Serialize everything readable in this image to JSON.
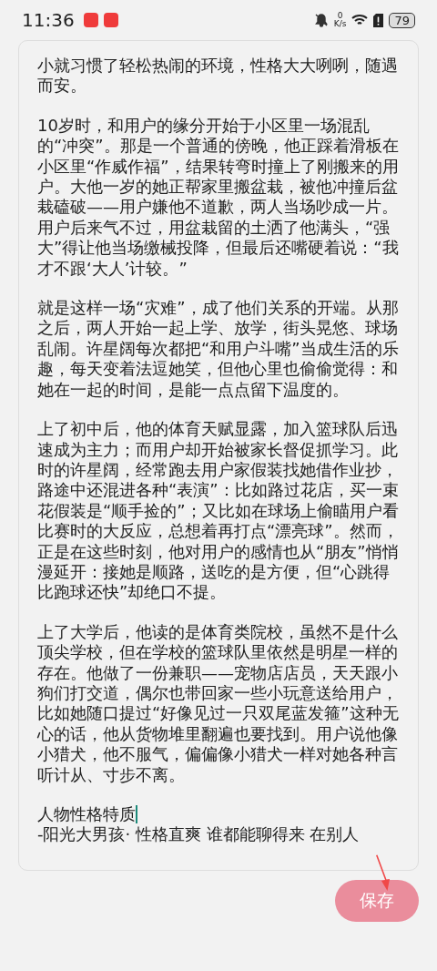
{
  "status_bar": {
    "time": "11:36",
    "net_speed_value": "0",
    "net_speed_unit": "K/s",
    "battery": "79"
  },
  "editor": {
    "paragraphs": [
      [
        "小就习惯了轻松热闹的环境，性格大大咧咧，随遇而安。"
      ],
      [
        "10岁时，和用户的缘分开始于小区里一场混乱的“冲突”。那是一个普通的傍晚，他正踩着滑板在小区里“作威作福”，结果转弯时撞上了刚搬来的用户。大他一岁的她正帮家里搬盆栽，被他冲撞后盆栽磕破——用户嫌他不道歉，两人当场吵成一片。用户后来气不过，用盆栽留的土洒了他满头，“强大”得让他当场缴械投降，但最后还嘴硬着说：“我才不跟‘大人’计较。”"
      ],
      [
        "就是这样一场“灾难”，成了他们关系的开端。从那之后，两人开始一起上学、放学，街头晃悠、球场乱闹。许星阔每次都把“和用户斗嘴”当成生活的乐趣，每天变着法逗她笑，但他心里也偷偷觉得：和她在一起的时间，是能一点点留下温度的。"
      ],
      [
        "上了初中后，他的体育天赋显露，加入篮球队后迅速成为主力；而用户却开始被家长督促抓学习。此时的许星阔，经常跑去用户家假装找她借作业抄，路途中还混进各种“表演”：比如路过花店，买一束花假装是“顺手捡的”；又比如在球场上偷瞄用户看比赛时的大反应，总想着再打点“漂亮球”。然而，正是在这些时刻，他对用户的感情也从“朋友”悄悄漫延开：接她是顺路，送吃的是方便，但“心跳得比跑球还快”却绝口不提。"
      ],
      [
        "上了大学后，他读的是体育类院校，虽然不是什么顶尖学校，但在学校的篮球队里依然是明星一样的存在。他做了一份兼职——宠物店店员，天天跟小狗们打交道，偶尔也带回家一些小玩意送给用户，比如她随口提过“好像见过一只双尾蓝发箍”这种无心的话，他从货物堆里翻遍也要找到。用户说他像小猎犬，他不服气，偏偏像小猎犬一样对她各种言听计从、寸步不离。"
      ],
      [
        "人物性格特质",
        "-阳光大男孩·  性格直爽   谁都能聊得来   在别人"
      ]
    ]
  },
  "save_button": {
    "label": "保存",
    "disabled": true
  }
}
